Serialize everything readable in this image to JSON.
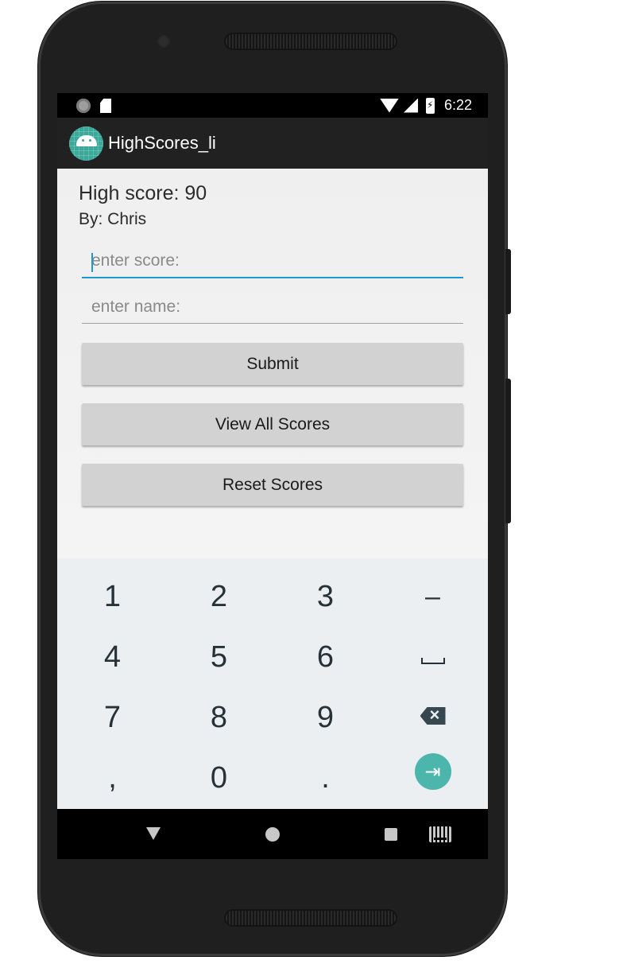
{
  "status_bar": {
    "time": "6:22",
    "icons": [
      "notification-dot-icon",
      "sd-card-icon",
      "wifi-icon",
      "signal-icon",
      "battery-charging-icon"
    ]
  },
  "app_bar": {
    "title": "HighScores_li",
    "icon": "android-app-icon"
  },
  "main": {
    "high_score_text": "High score: 90",
    "by_text": "By: Chris",
    "score_input": {
      "value": "",
      "placeholder": "enter score:"
    },
    "name_input": {
      "value": "",
      "placeholder": "enter name:"
    },
    "submit_label": "Submit",
    "view_all_label": "View All Scores",
    "reset_label": "Reset Scores"
  },
  "keyboard": {
    "keys": [
      "1",
      "2",
      "3",
      "–",
      "4",
      "5",
      "6",
      "space",
      "7",
      "8",
      "9",
      "backspace",
      ",",
      "0",
      ".",
      "next"
    ]
  },
  "nav_bar": {
    "buttons": [
      "back-icon",
      "home-icon",
      "recents-icon",
      "keyboard-switch-icon"
    ]
  },
  "colors": {
    "accent": "#1e9ad2",
    "keyboard_action": "#4db6ac",
    "app_bar": "#212121",
    "button": "#d2d2d2"
  }
}
